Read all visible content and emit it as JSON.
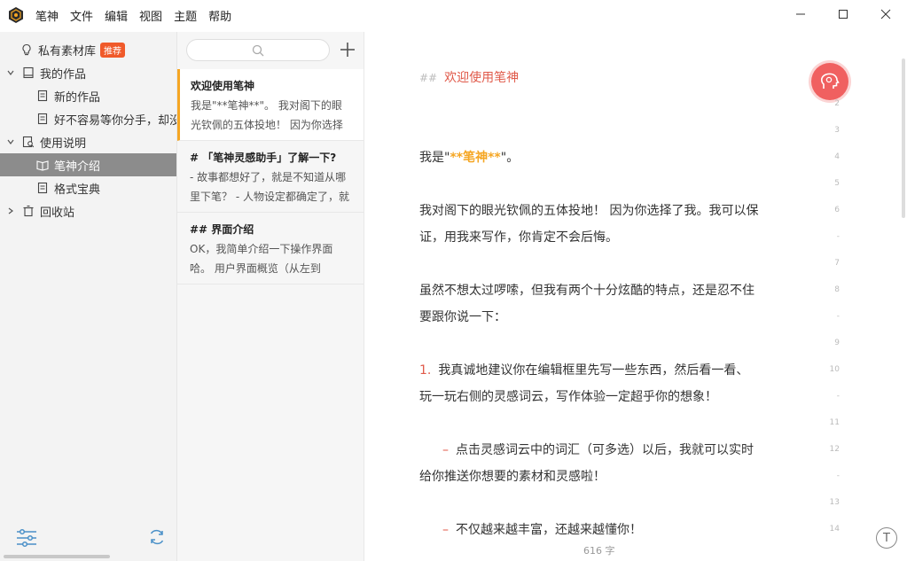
{
  "menu": [
    "笔神",
    "文件",
    "编辑",
    "视图",
    "主题",
    "帮助"
  ],
  "sidebar": {
    "library": {
      "label": "私有素材库",
      "badge": "推荐"
    },
    "works": {
      "label": "我的作品"
    },
    "work_items": [
      "新的作品",
      "好不容易等你分手，却没"
    ],
    "guide": {
      "label": "使用说明"
    },
    "guide_items": [
      "笔神介绍",
      "格式宝典"
    ],
    "trash": {
      "label": "回收站"
    }
  },
  "notelist": {
    "search_placeholder": "",
    "cards": [
      {
        "title": "欢迎使用笔神",
        "snippet": "我是\"**笔神**\"。 我对阁下的眼光钦佩的五体投地！ 因为你选择了"
      },
      {
        "title": "# 「笔神灵感助手」了解一下?",
        "snippet": "- 故事都想好了，就是不知道从哪里下笔？ - 人物设定都确定了，就"
      },
      {
        "title": "## 界面介绍",
        "snippet": "OK，我简单介绍一下操作界面哈。 用户界面概览（从左到"
      }
    ]
  },
  "editor": {
    "heading_mark": "##",
    "heading": "欢迎使用笔神",
    "p1_pre": "我是\"",
    "p1_bold": "**笔神**",
    "p1_post": "\"。",
    "p2a": "我对阁下的眼光钦佩的五体投地！  因为你选择了我。我可以保",
    "p2b": "证，用我来写作，你肯定不会后悔。",
    "p3a": "虽然不想太过啰嗦，但我有两个十分炫酷的特点，还是忍不住",
    "p3b": "要跟你说一下：",
    "li1_num": "1.",
    "li1a": "我真诚地建议你在编辑框里先写一些东西，然后看一看、",
    "li1b": "玩一玩右侧的灵感词云，写作体验一定超乎你的想象！",
    "sub1_dash": "–",
    "sub1a": "点击灵感词云中的词汇（可多选）以后，我就可以实时",
    "sub1b": "给你推送你想要的素材和灵感啦！",
    "sub2_dash": "–",
    "sub2": "不仅越来越丰富，还越来越懂你！",
    "word_count": "616 字",
    "font_button": "T",
    "line_numbers": [
      "2",
      "3",
      "4",
      "5",
      "6",
      "-",
      "7",
      "8",
      "-",
      "9",
      "10",
      "-",
      "11",
      "12",
      "-",
      "13",
      "14"
    ]
  },
  "colors": {
    "accent": "#f5a623",
    "heading": "#e05a4a",
    "badge": "#f05a2a",
    "selected": "#8c8c8c"
  }
}
